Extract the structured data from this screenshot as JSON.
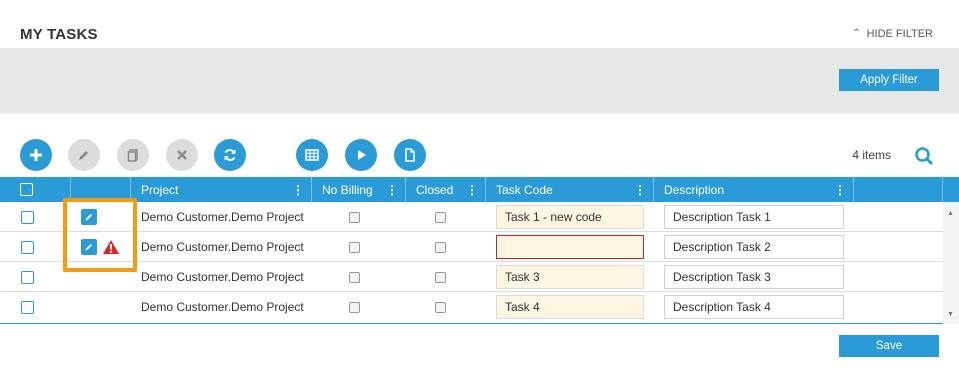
{
  "header": {
    "title": "MY TASKS",
    "hide_filter": "HIDE FILTER"
  },
  "filter": {
    "apply_label": "Apply Filter"
  },
  "toolbar": {
    "buttons": [
      {
        "name": "add",
        "icon": "plus-icon",
        "state": "active"
      },
      {
        "name": "edit",
        "icon": "pencil-icon",
        "state": "disabled"
      },
      {
        "name": "copy",
        "icon": "copy-icon",
        "state": "disabled"
      },
      {
        "name": "delete",
        "icon": "x-icon",
        "state": "disabled"
      },
      {
        "name": "refresh",
        "icon": "refresh-icon",
        "state": "active"
      },
      {
        "name": "grid",
        "icon": "table-icon",
        "state": "active"
      },
      {
        "name": "run",
        "icon": "play-icon",
        "state": "active"
      },
      {
        "name": "export",
        "icon": "document-icon",
        "state": "active"
      }
    ],
    "items_count": "4 items"
  },
  "grid": {
    "columns": {
      "project": "Project",
      "no_billing": "No Billing",
      "closed": "Closed",
      "task_code": "Task Code",
      "description": "Description"
    },
    "rows": [
      {
        "project": "Demo Customer.Demo Project",
        "task_code": "Task 1 - new code",
        "description": "Description Task 1",
        "edited": true,
        "error": false
      },
      {
        "project": "Demo Customer.Demo Project",
        "task_code": "",
        "description": "Description Task 2",
        "edited": true,
        "error": true
      },
      {
        "project": "Demo Customer.Demo Project",
        "task_code": "Task 3",
        "description": "Description Task 3",
        "edited": false,
        "error": false
      },
      {
        "project": "Demo Customer.Demo Project",
        "task_code": "Task 4",
        "description": "Description Task 4",
        "edited": false,
        "error": false
      }
    ]
  },
  "footer": {
    "save_label": "Save"
  },
  "colors": {
    "accent": "#2a9bd6",
    "highlight": "#f59b11",
    "error": "#b72e2e",
    "warning": "#d62828"
  }
}
